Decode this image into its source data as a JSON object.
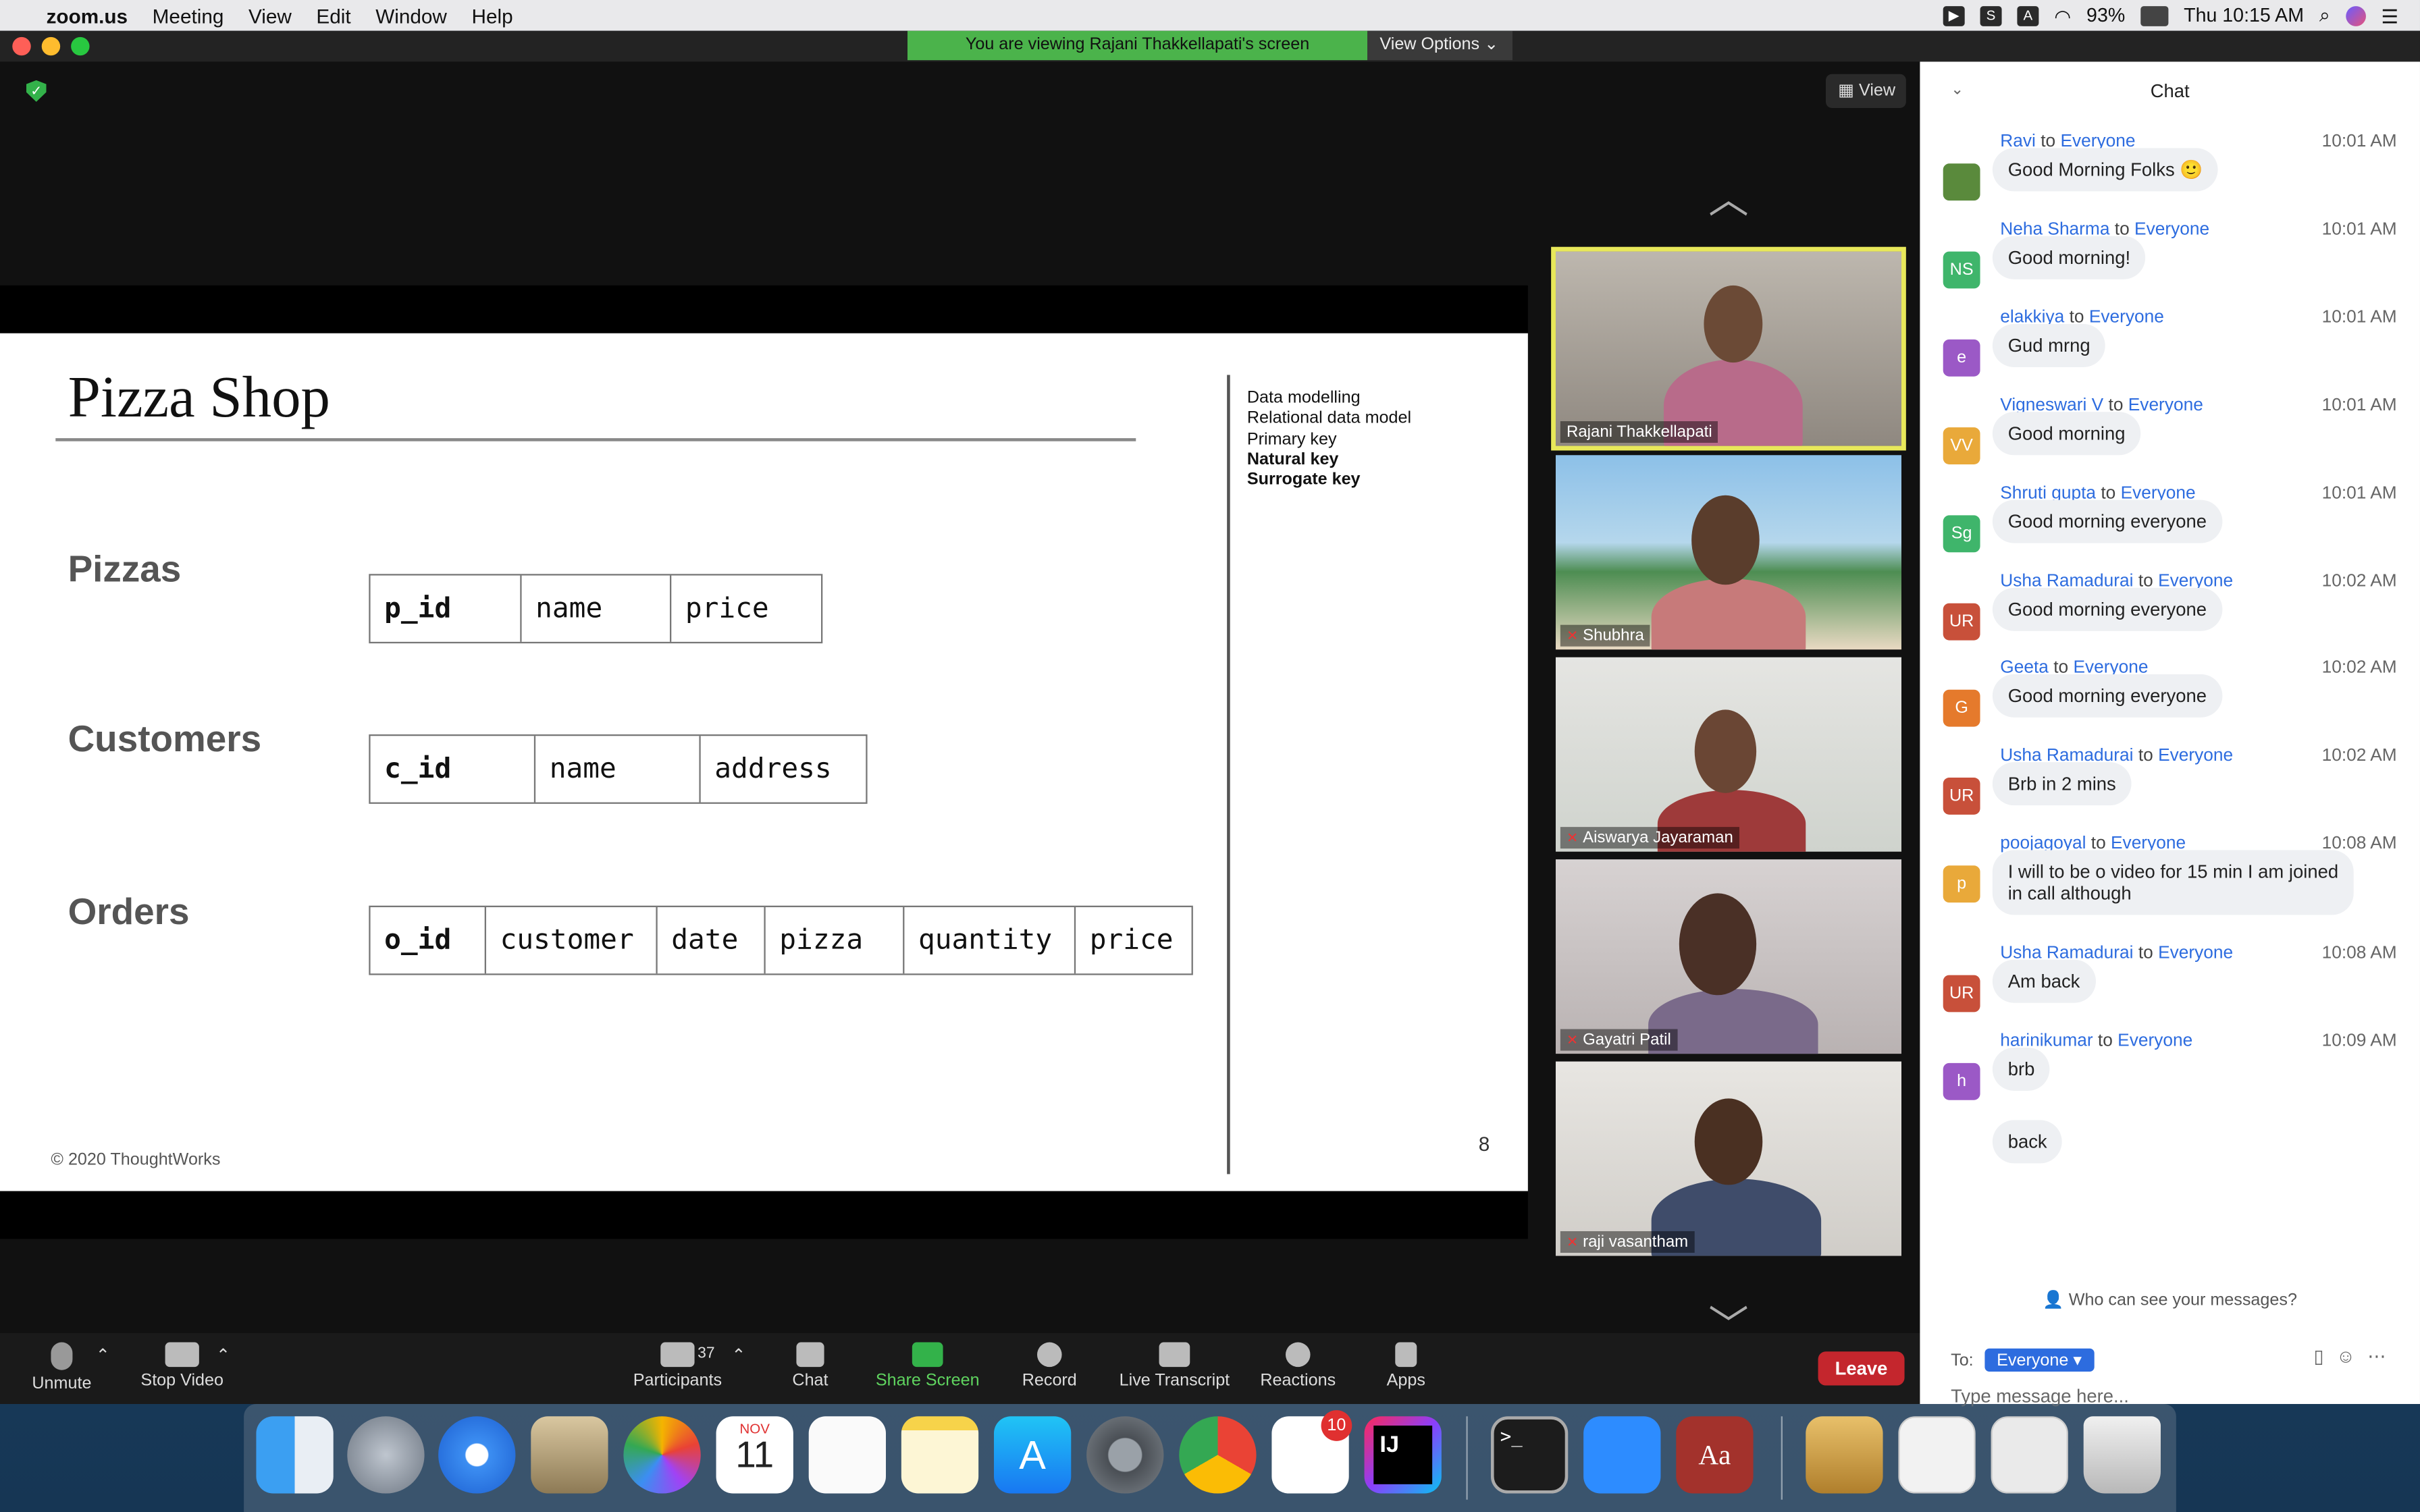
{
  "menubar": {
    "app": "zoom.us",
    "items": [
      "Meeting",
      "View",
      "Edit",
      "Window",
      "Help"
    ],
    "battery": "93%",
    "clock": "Thu 10:15 AM"
  },
  "banner": {
    "viewing": "You are viewing Rajani Thakkellapati's screen",
    "view_options": "View Options ⌄"
  },
  "stage": {
    "view_label": "View"
  },
  "slide": {
    "title": "Pizza Shop",
    "topics": [
      "Data modelling",
      "Relational data model",
      "Primary key",
      "Natural key",
      "Surrogate key"
    ],
    "tables": [
      {
        "label": "Pizzas",
        "columns": [
          "p_id",
          "name",
          "price"
        ]
      },
      {
        "label": "Customers",
        "columns": [
          "c_id",
          "name",
          "address"
        ]
      },
      {
        "label": "Orders",
        "columns": [
          "o_id",
          "customer",
          "date",
          "pizza",
          "quantity",
          "price"
        ]
      }
    ],
    "footer": "© 2020 ThoughtWorks",
    "page": "8"
  },
  "gallery": [
    {
      "name": "Rajani Thakkellapati",
      "muted": false,
      "active": true
    },
    {
      "name": "Shubhra",
      "muted": true
    },
    {
      "name": "Aiswarya Jayaraman",
      "muted": true
    },
    {
      "name": "Gayatri Patil",
      "muted": true
    },
    {
      "name": "raji vasantham",
      "muted": true
    }
  ],
  "toolbar": {
    "unmute": "Unmute",
    "stop_video": "Stop Video",
    "participants": "Participants",
    "participants_count": "37",
    "chat": "Chat",
    "share_screen": "Share Screen",
    "record": "Record",
    "live_transcript": "Live Transcript",
    "reactions": "Reactions",
    "apps": "Apps",
    "leave": "Leave"
  },
  "chat": {
    "title": "Chat",
    "to_label": "to",
    "messages": [
      {
        "sender": "Ravi",
        "to": "Everyone",
        "time": "10:01 AM",
        "text": "Good Morning Folks 🙂",
        "avatar": "",
        "color": "#5a8a3c"
      },
      {
        "sender": "Neha Sharma",
        "to": "Everyone",
        "time": "10:01 AM",
        "text": "Good morning!",
        "avatar": "NS",
        "color": "#3fb56b"
      },
      {
        "sender": "elakkiya",
        "to": "Everyone",
        "time": "10:01 AM",
        "text": "Gud mrng",
        "avatar": "e",
        "color": "#9b59c6"
      },
      {
        "sender": "Vigneswari V",
        "to": "Everyone",
        "time": "10:01 AM",
        "text": "Good morning",
        "avatar": "VV",
        "color": "#e9a93a"
      },
      {
        "sender": "Shruti gupta",
        "to": "Everyone",
        "time": "10:01 AM",
        "text": "Good morning everyone",
        "avatar": "Sg",
        "color": "#3fb56b"
      },
      {
        "sender": "Usha Ramadurai",
        "to": "Everyone",
        "time": "10:02 AM",
        "text": "Good morning everyone",
        "avatar": "UR",
        "color": "#c8503a"
      },
      {
        "sender": "Geeta",
        "to": "Everyone",
        "time": "10:02 AM",
        "text": "Good morning everyone",
        "avatar": "G",
        "color": "#e57a2c"
      },
      {
        "sender": "Usha Ramadurai",
        "to": "Everyone",
        "time": "10:02 AM",
        "text": "Brb in 2 mins",
        "avatar": "UR",
        "color": "#c8503a"
      },
      {
        "sender": "poojagoyal",
        "to": "Everyone",
        "time": "10:08 AM",
        "text": "I will to be o video for 15 min I am joined\nin call although",
        "avatar": "p",
        "color": "#e9a93a"
      },
      {
        "sender": "Usha Ramadurai",
        "to": "Everyone",
        "time": "10:08 AM",
        "text": "Am back",
        "avatar": "UR",
        "color": "#c8503a"
      },
      {
        "sender": "harinikumar",
        "to": "Everyone",
        "time": "10:09 AM",
        "text": "brb",
        "avatar": "h",
        "color": "#9b59c6"
      }
    ],
    "followup": "back",
    "who_can_see": "Who can see your messages?",
    "to_prefix": "To:",
    "to_value": "Everyone",
    "input_placeholder": "Type message here..."
  },
  "dock": {
    "calendar_month": "NOV",
    "calendar_day": "11",
    "slack_badge": "10",
    "intellij_label": "IJ",
    "dictionary_label": "Aa"
  }
}
